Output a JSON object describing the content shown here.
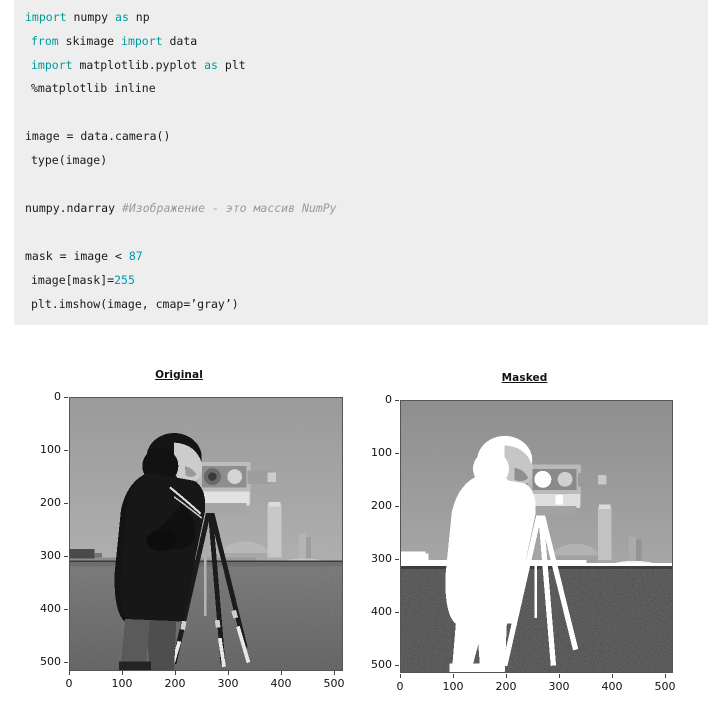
{
  "notebook": {
    "cell_background": "#eeeeee",
    "code_groups": [
      {
        "name": "imports",
        "lines": [
          [
            {
              "t": "import",
              "c": "kw"
            },
            {
              "t": " numpy ",
              "c": "plain"
            },
            {
              "t": "as",
              "c": "kw"
            },
            {
              "t": " np",
              "c": "plain"
            }
          ],
          [
            {
              "t": "from",
              "c": "kw"
            },
            {
              "t": " skimage ",
              "c": "plain"
            },
            {
              "t": "import",
              "c": "kw"
            },
            {
              "t": " data",
              "c": "plain"
            }
          ],
          [
            {
              "t": "import",
              "c": "kw"
            },
            {
              "t": " matplotlib.pyplot ",
              "c": "plain"
            },
            {
              "t": "as",
              "c": "kw"
            },
            {
              "t": " plt",
              "c": "plain"
            }
          ],
          [
            {
              "t": "%matplotlib inline",
              "c": "magic"
            }
          ]
        ]
      },
      {
        "name": "load-image",
        "lines": [
          [
            {
              "t": "image = data.camera()",
              "c": "plain"
            }
          ],
          [
            {
              "t": "type(image)",
              "c": "plain"
            }
          ]
        ]
      },
      {
        "name": "output-ndarray",
        "lines": [
          [
            {
              "t": "numpy.ndarray ",
              "c": "plain"
            },
            {
              "t": "#Изображение - это массив NumPy",
              "c": "cmt"
            }
          ]
        ]
      },
      {
        "name": "mask-and-show",
        "lines": [
          [
            {
              "t": "mask = image < ",
              "c": "plain"
            },
            {
              "t": "87",
              "c": "num"
            }
          ],
          [
            {
              "t": "image[mask]=",
              "c": "plain"
            },
            {
              "t": "255",
              "c": "num"
            }
          ],
          [
            {
              "t": "plt.imshow(image, cmap=’gray’)",
              "c": "plain"
            }
          ]
        ]
      }
    ],
    "syntax_colors": {
      "keyword": "#009999",
      "number": "#0099aa",
      "comment": "#9a9a9a",
      "plain": "#1a1a1a"
    }
  },
  "figure": {
    "subplots": [
      {
        "name": "original",
        "title": "Original",
        "image_description": "camera",
        "yticks": [
          "0",
          "100",
          "200",
          "300",
          "400",
          "500"
        ],
        "xticks": [
          "0",
          "100",
          "200",
          "300",
          "400",
          "500"
        ]
      },
      {
        "name": "masked",
        "title": "Masked",
        "image_description": "camera-masked",
        "yticks": [
          "0",
          "100",
          "200",
          "300",
          "400",
          "500"
        ],
        "xticks": [
          "0",
          "100",
          "200",
          "300",
          "400",
          "500"
        ]
      }
    ]
  },
  "chart_data": {
    "type": "heatmap",
    "title": "",
    "panels": [
      {
        "title": "Original",
        "colormap": "gray",
        "data_source": "skimage.data.camera()",
        "shape": [
          512,
          512
        ],
        "vmin": 0,
        "vmax": 255,
        "xlabel": "",
        "ylabel": "",
        "xlim": [
          0,
          512
        ],
        "ylim": [
          512,
          0
        ],
        "xticks": [
          0,
          100,
          200,
          300,
          400,
          500
        ],
        "yticks": [
          0,
          100,
          200,
          300,
          400,
          500
        ],
        "grid": false
      },
      {
        "title": "Masked",
        "colormap": "gray",
        "data_source": "image with image < 87 set to 255",
        "shape": [
          512,
          512
        ],
        "vmin": 0,
        "vmax": 255,
        "threshold": 87,
        "fill_value": 255,
        "xlabel": "",
        "ylabel": "",
        "xlim": [
          0,
          512
        ],
        "ylim": [
          512,
          0
        ],
        "xticks": [
          0,
          100,
          200,
          300,
          400,
          500
        ],
        "yticks": [
          0,
          100,
          200,
          300,
          400,
          500
        ],
        "grid": false
      }
    ]
  }
}
